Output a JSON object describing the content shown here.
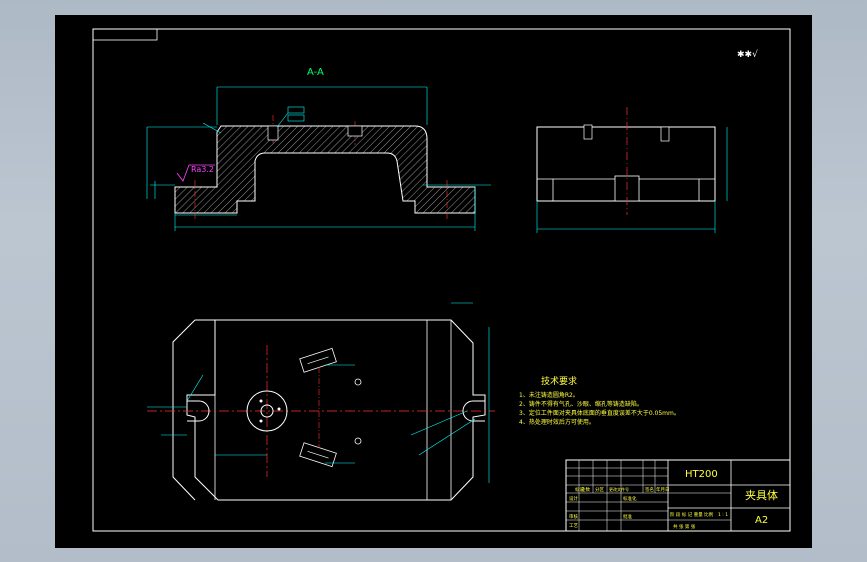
{
  "drawing": {
    "section_label": "A-A",
    "surface_finish_symbol": "✱✱√",
    "roughness_callout": "Ra3.2",
    "tech_requirements": {
      "title": "技术要求",
      "items": [
        "1、未注铸造圆角R2。",
        "2、铸件不得有气孔、沙眼、缩孔等铸造缺陷。",
        "3、定位工件面对夹具体底面的垂直度误差不大于0.05mm。",
        "4、热处理时效后方可使用。"
      ]
    },
    "title_block": {
      "material": "HT200",
      "part_name": "夹具体",
      "sheet_size": "A2",
      "stage_row": "阶 段 标 记    重量  比例",
      "scale_hint": "1 : 1",
      "sheet_row": "共    张  第    张",
      "row_labels": [
        "标记",
        "处数",
        "分区",
        "更改文件号",
        "签名",
        "年月日"
      ],
      "left_labels": [
        "设计",
        "审核",
        "工艺"
      ],
      "mid_labels": [
        "标准化",
        "批准"
      ]
    }
  },
  "colors": {
    "background": "#000000",
    "outline": "#ffffff",
    "dimension": "#00ffff",
    "centerline": "#ff3030",
    "annotation": "#ff40ff",
    "text_yellow": "#ffff40",
    "hatch": "#ffffff"
  }
}
